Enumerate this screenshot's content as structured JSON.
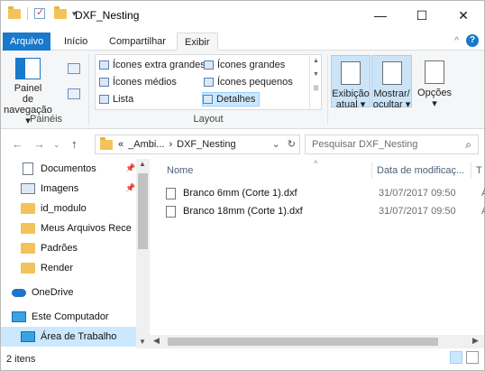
{
  "window": {
    "title": "DXF_Nesting"
  },
  "window_controls": {
    "minimize": "—",
    "maximize": "☐",
    "close": "✕"
  },
  "ribbon_tabs": [
    {
      "label": "Arquivo"
    },
    {
      "label": "Início"
    },
    {
      "label": "Compartilhar"
    },
    {
      "label": "Exibir"
    }
  ],
  "ribbon": {
    "navigation_pane": {
      "line1": "Painel de",
      "line2": "navegação ▾"
    },
    "group_panes": "Painéis",
    "layout_options": [
      "Ícones extra grandes",
      "Ícones grandes",
      "Ícones médios",
      "Ícones pequenos",
      "Lista",
      "Detalhes"
    ],
    "group_layout": "Layout",
    "current_view": {
      "line1": "Exibição",
      "line2": "atual ▾"
    },
    "show_hide": {
      "line1": "Mostrar/",
      "line2": "ocultar ▾"
    },
    "options": {
      "line1": "Opções",
      "line2": "▾"
    }
  },
  "address": {
    "overflow": "«",
    "crumbs": [
      "_Ambi...",
      "›",
      "DXF_Nesting"
    ],
    "search_placeholder": "Pesquisar DXF_Nesting"
  },
  "nav_pane": {
    "items": [
      {
        "label": "Documentos",
        "icon": "document-icon",
        "pinned": true
      },
      {
        "label": "Imagens",
        "icon": "pictures-icon",
        "pinned": true
      },
      {
        "label": "id_modulo",
        "icon": "folder-icon"
      },
      {
        "label": "Meus Arquivos Rece",
        "icon": "folder-icon"
      },
      {
        "label": "Padrões",
        "icon": "folder-icon"
      },
      {
        "label": "Render",
        "icon": "folder-icon"
      },
      {
        "label": "OneDrive",
        "icon": "onedrive-icon"
      },
      {
        "label": "Este Computador",
        "icon": "computer-icon"
      },
      {
        "label": "Área de Trabalho",
        "icon": "desktop-icon",
        "selected": true
      }
    ]
  },
  "columns": {
    "name": "Nome",
    "date": "Data de modificaç...",
    "type": "T"
  },
  "files": [
    {
      "name": "Branco 6mm (Corte 1).dxf",
      "date": "31/07/2017 09:50",
      "type": "A"
    },
    {
      "name": "Branco 18mm (Corte 1).dxf",
      "date": "31/07/2017 09:50",
      "type": "A"
    }
  ],
  "status": {
    "count": "2 itens"
  },
  "colors": {
    "accent": "#1979ca",
    "selection": "#cce8ff",
    "folder": "#f4c25a"
  }
}
